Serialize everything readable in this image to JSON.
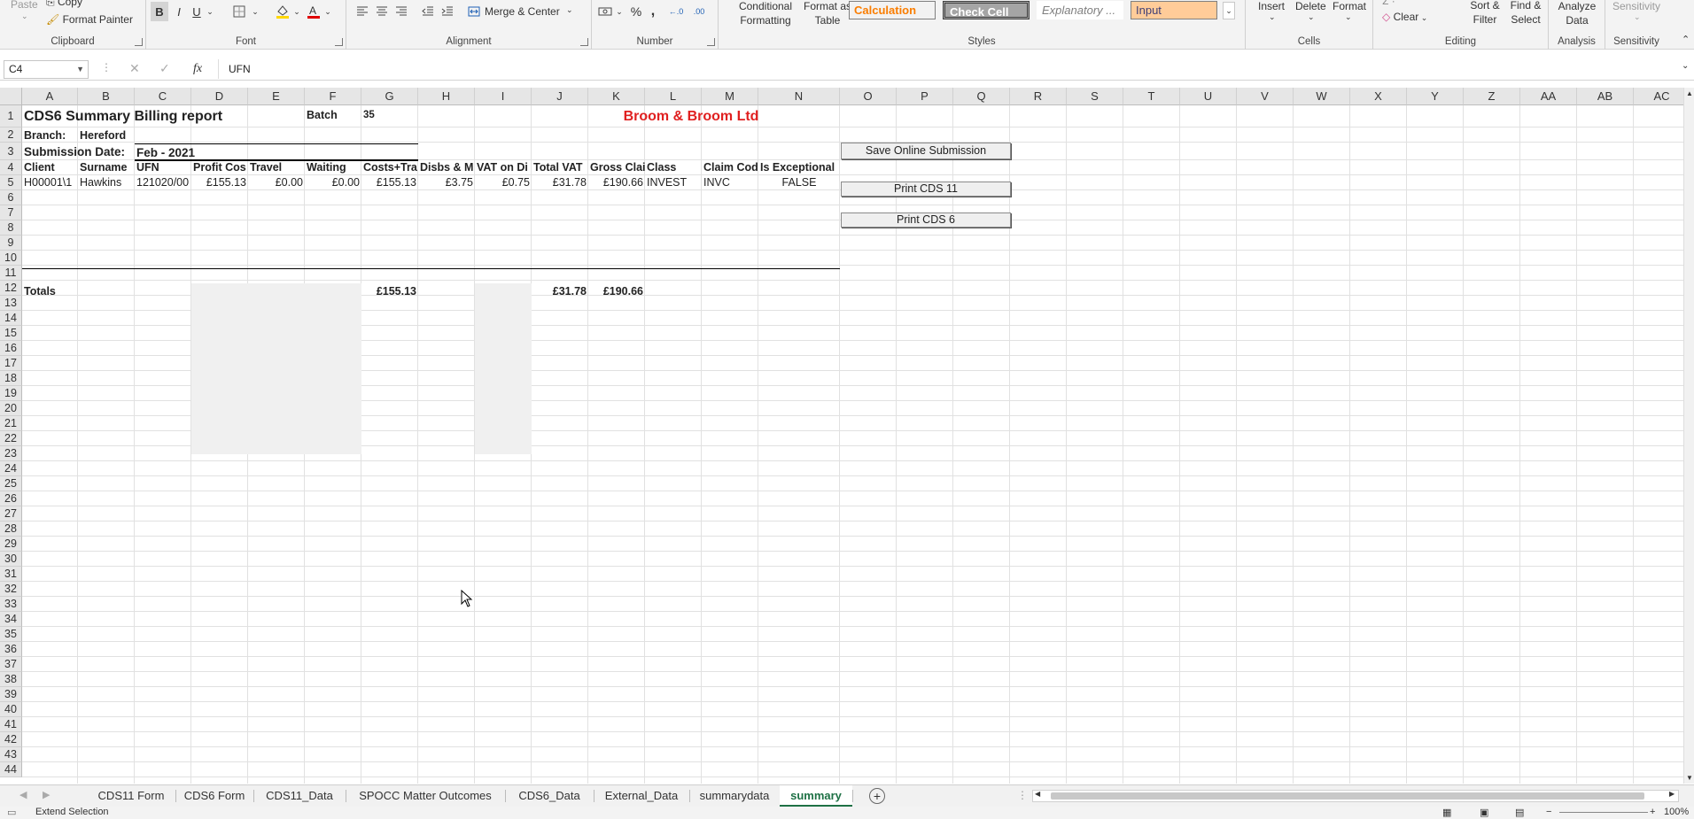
{
  "ribbon": {
    "clipboard": {
      "paste": "Paste",
      "copy": "Copy",
      "format_painter": "Format Painter",
      "label": "Clipboard"
    },
    "font": {
      "bold": "B",
      "italic": "I",
      "underline": "U",
      "label": "Font"
    },
    "alignment": {
      "merge_center": "Merge & Center",
      "label": "Alignment"
    },
    "number": {
      "percent": "%",
      "comma": ",",
      "inc_dec": "←.0",
      "dec_dec": ".00",
      "label": "Number"
    },
    "styles": {
      "conditional_formatting": "Conditional Formatting",
      "format_as_table": "Format as Table",
      "calculation": "Calculation",
      "check_cell": "Check Cell",
      "explanatory": "Explanatory ...",
      "input": "Input",
      "label": "Styles"
    },
    "cells": {
      "insert": "Insert",
      "delete": "Delete",
      "format": "Format",
      "label": "Cells"
    },
    "editing": {
      "clear": "Clear",
      "sort_filter": "Sort & Filter",
      "find_select": "Find & Select",
      "label": "Editing"
    },
    "analysis": {
      "analyze_data": "Analyze Data",
      "label": "Analysis"
    },
    "sensitivity": {
      "sensitivity": "Sensitivity",
      "label": "Sensitivity"
    }
  },
  "formula_bar": {
    "name_box": "C4",
    "fx": "fx",
    "content": "UFN"
  },
  "columns": [
    "A",
    "B",
    "C",
    "D",
    "E",
    "F",
    "G",
    "H",
    "I",
    "J",
    "K",
    "L",
    "M",
    "N",
    "O",
    "P",
    "Q",
    "R",
    "S",
    "T",
    "U",
    "V",
    "W",
    "X",
    "Y",
    "Z",
    "AA",
    "AB",
    "AC"
  ],
  "rows": [
    "1",
    "2",
    "3",
    "4",
    "5",
    "6",
    "7",
    "8",
    "9",
    "10",
    "11",
    "12",
    "13",
    "14",
    "15",
    "16",
    "17",
    "18",
    "19",
    "20",
    "21",
    "22",
    "23",
    "24",
    "25",
    "26",
    "27",
    "28",
    "29",
    "30",
    "31",
    "32",
    "33",
    "34",
    "35",
    "36",
    "37",
    "38",
    "39",
    "40",
    "41",
    "42",
    "43",
    "44"
  ],
  "sheet": {
    "title": "CDS6 Summary Billing report",
    "batch_label": "Batch",
    "batch_value": "35",
    "company": "Broom & Broom Ltd",
    "branch_label": "Branch:",
    "branch_value": "Hereford",
    "submission_label": "Submission Date:",
    "submission_value": "Feb - 2021",
    "headers": [
      "Client",
      "Surname",
      "UFN",
      "Profit Cos",
      "Travel",
      "Waiting",
      "Costs+Tra",
      "Disbs & M",
      "VAT on Di",
      "Total VAT",
      "Gross Clai",
      "Class",
      "Claim Cod",
      "Is Exceptional"
    ],
    "data_row": [
      "H00001\\1",
      "Hawkins",
      "121020/00",
      "£155.13",
      "£0.00",
      "£0.00",
      "£155.13",
      "£3.75",
      "£0.75",
      "£31.78",
      "£190.66",
      "INVEST",
      "INVC",
      "FALSE"
    ],
    "totals_label": "Totals",
    "totals_g": "£155.13",
    "totals_j": "£31.78",
    "totals_k": "£190.66"
  },
  "buttons": {
    "save_online": "Save Online Submission",
    "print_cds11": "Print CDS 11",
    "print_cds6": "Print CDS 6"
  },
  "tabs": [
    "CDS11 Form",
    "CDS6 Form",
    "CDS11_Data",
    "SPOCC Matter Outcomes",
    "CDS6_Data",
    "External_Data",
    "summarydata",
    "summary"
  ],
  "active_tab": "summary",
  "status": {
    "mode": "Extend Selection",
    "zoom": "100%"
  }
}
